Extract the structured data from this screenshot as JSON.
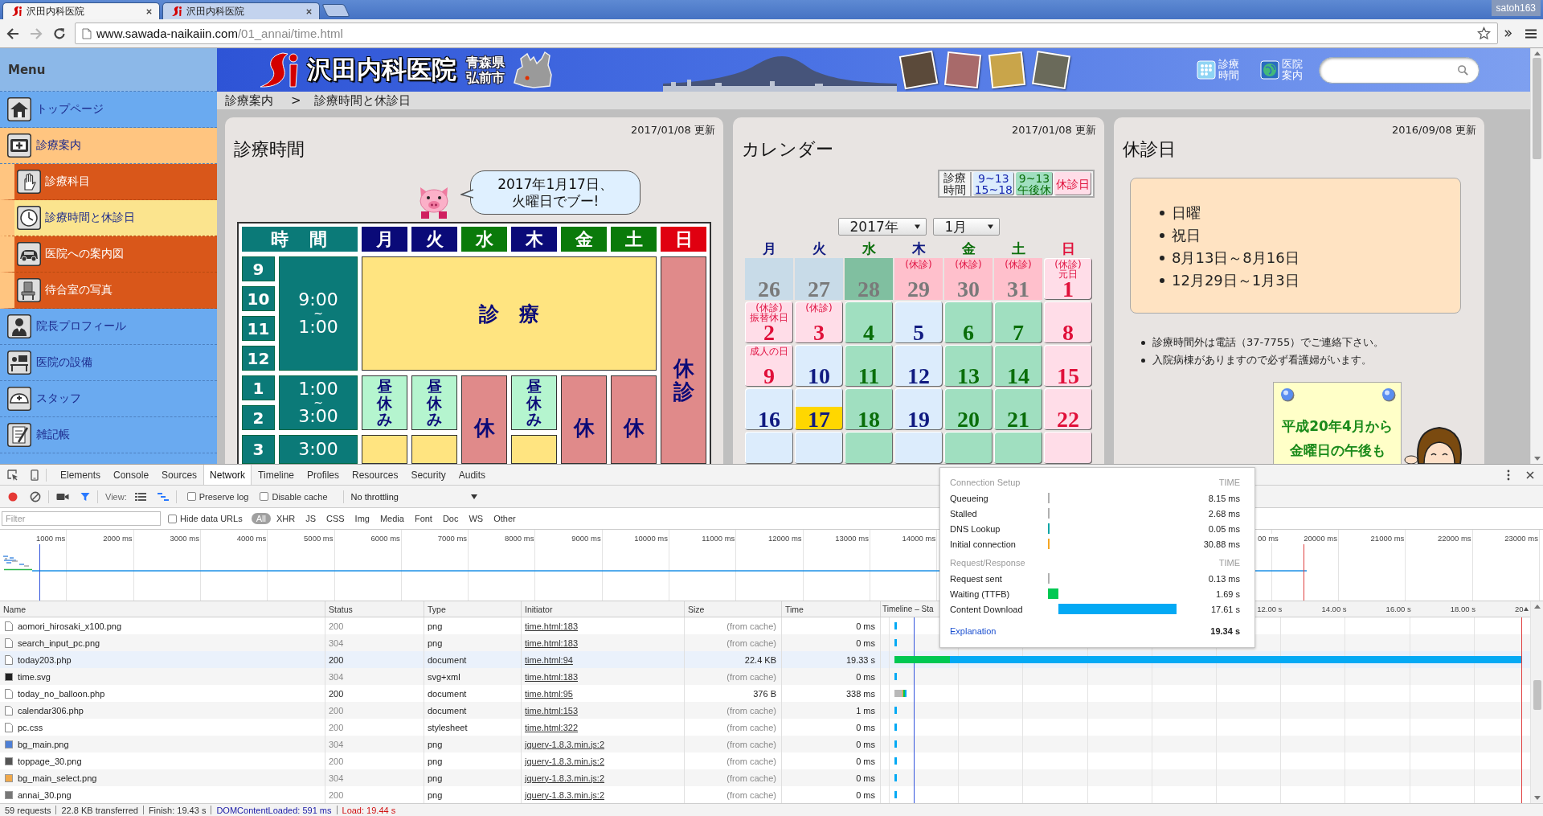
{
  "browser": {
    "tabs": [
      {
        "title": "沢田内科医院",
        "selected": true
      },
      {
        "title": "沢田内科医院",
        "selected": false
      }
    ],
    "profile": "satoh163",
    "address": {
      "host": "www.sawada-naikaiin.com",
      "path": "/01_annai/time.html"
    }
  },
  "sidebar": {
    "title": "Menu",
    "items": [
      {
        "label": "トップページ",
        "selected": false,
        "expanded": false
      },
      {
        "label": "診療案内",
        "selected": false,
        "expanded": true,
        "children": [
          {
            "label": "診療科目",
            "selected": false
          },
          {
            "label": "診療時間と休診日",
            "selected": true
          },
          {
            "label": "医院への案内図",
            "selected": false
          },
          {
            "label": "待合室の写真",
            "selected": false
          }
        ]
      },
      {
        "label": "院長プロフィール",
        "selected": false,
        "expanded": false
      },
      {
        "label": "医院の設備",
        "selected": false,
        "expanded": false
      },
      {
        "label": "スタッフ",
        "selected": false,
        "expanded": false
      },
      {
        "label": "雑記帳",
        "selected": false,
        "expanded": false
      }
    ]
  },
  "banner": {
    "clinic_name": "沢田内科医院",
    "location": [
      "青森県",
      "弘前市"
    ],
    "links": [
      {
        "label": "診療時間"
      },
      {
        "label": "医院案内"
      }
    ]
  },
  "breadcrumb": {
    "items": [
      "診療案内",
      "診療時間と休診日"
    ],
    "separator": ">"
  },
  "hours_panel": {
    "updated": "2017/01/08 更新",
    "title": "診療時間",
    "speech": [
      "2017年1月17日、",
      "火曜日でブー!"
    ],
    "table": {
      "columns": [
        {
          "label": "時　間",
          "color": "#0b7a78"
        },
        {
          "label": "月",
          "color": "#0a0a78"
        },
        {
          "label": "火",
          "color": "#0a0a78"
        },
        {
          "label": "水",
          "color": "#0a7a0a"
        },
        {
          "label": "木",
          "color": "#0a0a78"
        },
        {
          "label": "金",
          "color": "#0a7a0a"
        },
        {
          "label": "土",
          "color": "#0a7a0a"
        },
        {
          "label": "日",
          "color": "#e00010"
        }
      ],
      "hours": [
        "9",
        "10",
        "11",
        "12",
        "1",
        "2",
        "3"
      ],
      "ranges": [
        {
          "from": "9:00",
          "sep": "~",
          "to": "1:00"
        },
        {
          "from": "1:00",
          "sep": "~",
          "to": "3:00"
        },
        {
          "from": "3:00"
        }
      ],
      "morning": {
        "kind": "consult",
        "label": "診　療"
      },
      "afternoon": [
        {
          "kind": "lunch",
          "label": "昼休み"
        },
        {
          "kind": "lunch",
          "label": "昼休み"
        },
        {
          "kind": "closed",
          "label": "休"
        },
        {
          "kind": "lunch",
          "label": "昼休み"
        },
        {
          "kind": "closed",
          "label": "休"
        },
        {
          "kind": "closed",
          "label": "休"
        }
      ],
      "evening": [
        {
          "kind": "consult"
        },
        {
          "kind": "consult"
        },
        {
          "kind": "continued"
        },
        {
          "kind": "consult"
        },
        {
          "kind": "continued"
        },
        {
          "kind": "continued"
        }
      ],
      "sunday": {
        "kind": "closed",
        "label": "休診"
      }
    }
  },
  "calendar_panel": {
    "updated": "2017/01/08 更新",
    "title": "カレンダー",
    "legend": {
      "title": "診療時間",
      "items": [
        {
          "kind": "consult",
          "lines": [
            "9~13",
            "15~18"
          ]
        },
        {
          "kind": "half",
          "lines": [
            "9~13",
            "午後休"
          ]
        },
        {
          "kind": "closed",
          "lines": [
            "休診日"
          ]
        }
      ]
    },
    "year": "2017年",
    "month": "1月",
    "weekdays": [
      {
        "label": "月",
        "color": "#101a80"
      },
      {
        "label": "火",
        "color": "#101a80"
      },
      {
        "label": "水",
        "color": "#0a6e0a"
      },
      {
        "label": "木",
        "color": "#101a80"
      },
      {
        "label": "金",
        "color": "#0a6e0a"
      },
      {
        "label": "土",
        "color": "#0a6e0a"
      },
      {
        "label": "日",
        "color": "#e0103a"
      }
    ],
    "days": [
      {
        "day": "26",
        "kind": "consult",
        "in_month": false,
        "today": false
      },
      {
        "day": "27",
        "kind": "consult",
        "in_month": false,
        "today": false
      },
      {
        "day": "28",
        "kind": "half",
        "in_month": false,
        "today": false
      },
      {
        "day": "29",
        "kind": "closed",
        "in_month": false,
        "today": false,
        "notes": [
          "(休診)"
        ]
      },
      {
        "day": "30",
        "kind": "closed",
        "in_month": false,
        "today": false,
        "notes": [
          "(休診)"
        ]
      },
      {
        "day": "31",
        "kind": "closed",
        "in_month": false,
        "today": false,
        "notes": [
          "(休診)"
        ]
      },
      {
        "day": "1",
        "kind": "closed",
        "in_month": true,
        "today": false,
        "notes": [
          "(休診)",
          "元日"
        ]
      },
      {
        "day": "2",
        "kind": "closed",
        "in_month": true,
        "today": false,
        "notes": [
          "(休診)",
          "振替休日"
        ]
      },
      {
        "day": "3",
        "kind": "closed",
        "in_month": true,
        "today": false,
        "notes": [
          "(休診)"
        ]
      },
      {
        "day": "4",
        "kind": "half",
        "in_month": true,
        "today": false
      },
      {
        "day": "5",
        "kind": "consult",
        "in_month": true,
        "today": false
      },
      {
        "day": "6",
        "kind": "half",
        "in_month": true,
        "today": false
      },
      {
        "day": "7",
        "kind": "half",
        "in_month": true,
        "today": false
      },
      {
        "day": "8",
        "kind": "closed",
        "in_month": true,
        "today": false
      },
      {
        "day": "9",
        "kind": "closed",
        "in_month": true,
        "today": false,
        "notes": [
          "成人の日"
        ]
      },
      {
        "day": "10",
        "kind": "consult",
        "in_month": true,
        "today": false
      },
      {
        "day": "11",
        "kind": "half",
        "in_month": true,
        "today": false
      },
      {
        "day": "12",
        "kind": "consult",
        "in_month": true,
        "today": false
      },
      {
        "day": "13",
        "kind": "half",
        "in_month": true,
        "today": false
      },
      {
        "day": "14",
        "kind": "half",
        "in_month": true,
        "today": false
      },
      {
        "day": "15",
        "kind": "closed",
        "in_month": true,
        "today": false
      },
      {
        "day": "16",
        "kind": "consult",
        "in_month": true,
        "today": false
      },
      {
        "day": "17",
        "kind": "consult",
        "in_month": true,
        "today": true
      },
      {
        "day": "18",
        "kind": "half",
        "in_month": true,
        "today": false
      },
      {
        "day": "19",
        "kind": "consult",
        "in_month": true,
        "today": false
      },
      {
        "day": "20",
        "kind": "half",
        "in_month": true,
        "today": false
      },
      {
        "day": "21",
        "kind": "half",
        "in_month": true,
        "today": false
      },
      {
        "day": "22",
        "kind": "closed",
        "in_month": true,
        "today": false
      },
      {
        "kind": "consult",
        "in_month": true,
        "today": false
      },
      {
        "kind": "consult",
        "in_month": true,
        "today": false
      },
      {
        "kind": "half",
        "in_month": true,
        "today": false
      },
      {
        "kind": "consult",
        "in_month": true,
        "today": false
      },
      {
        "kind": "half",
        "in_month": true,
        "today": false
      },
      {
        "kind": "half",
        "in_month": true,
        "today": false
      },
      {
        "kind": "closed",
        "in_month": true,
        "today": false
      }
    ]
  },
  "closed_panel": {
    "updated": "2016/09/08 更新",
    "title": "休診日",
    "closed_days": [
      "日曜",
      "祝日",
      "8月13日～8月16日",
      "12月29日～1月3日"
    ],
    "notes": [
      "診療時間外は電話（37-7755）でご連絡下さい。",
      "入院病棟がありますので必ず看護婦がいます。"
    ],
    "notice": [
      "平成20年4月から",
      "金曜日の午後も"
    ]
  },
  "devtools": {
    "tabs": [
      {
        "label": "Elements",
        "selected": false
      },
      {
        "label": "Console",
        "selected": false
      },
      {
        "label": "Sources",
        "selected": false
      },
      {
        "label": "Network",
        "selected": true
      },
      {
        "label": "Timeline",
        "selected": false
      },
      {
        "label": "Profiles",
        "selected": false
      },
      {
        "label": "Resources",
        "selected": false
      },
      {
        "label": "Security",
        "selected": false
      },
      {
        "label": "Audits",
        "selected": false
      }
    ],
    "toolbar": {
      "recording": true,
      "filter_shown": true,
      "view_label": "View:",
      "large_rows": false,
      "overview": true,
      "options": [
        {
          "label": "Preserve log",
          "checked": false
        },
        {
          "label": "Disable cache",
          "checked": false
        }
      ],
      "throttling": "No throttling"
    },
    "filter_bar": {
      "placeholder": "Filter",
      "hide_data_urls": {
        "label": "Hide data URLs",
        "checked": false
      },
      "types": [
        {
          "label": "All",
          "selected": true
        },
        {
          "label": "XHR",
          "selected": false
        },
        {
          "label": "JS",
          "selected": false
        },
        {
          "label": "CSS",
          "selected": false
        },
        {
          "label": "Img",
          "selected": false
        },
        {
          "label": "Media",
          "selected": false
        },
        {
          "label": "Font",
          "selected": false
        },
        {
          "label": "Doc",
          "selected": false
        },
        {
          "label": "WS",
          "selected": false
        },
        {
          "label": "Other",
          "selected": false
        }
      ]
    },
    "overview": {
      "ticks_start": [
        "1000 ms",
        "2000 ms",
        "3000 ms",
        "4000 ms",
        "5000 ms",
        "6000 ms",
        "7000 ms",
        "8000 ms",
        "9000 ms",
        "10000 ms",
        "11000 ms",
        "12000 ms",
        "13000 ms",
        "14000 ms"
      ],
      "ticks_end": [
        "00 ms",
        "20000 ms",
        "21000 ms",
        "22000 ms",
        "23000 ms"
      ]
    },
    "table": {
      "columns": [
        "Name",
        "Status",
        "Type",
        "Initiator",
        "Size",
        "Time",
        "Timeline – Sta"
      ],
      "waterfall_ticks": [
        "12.00 s",
        "14.00 s",
        "16.00 s",
        "18.00 s",
        "20"
      ],
      "rows": [
        {
          "name": "aomori_hirosaki_x100.png",
          "status": "200",
          "type": "png",
          "initiator": "time.html:183",
          "size": "(from cache)",
          "time": "0 ms",
          "cached": true,
          "hovered": false,
          "kind": "cache"
        },
        {
          "name": "search_input_pc.png",
          "status": "304",
          "type": "png",
          "initiator": "time.html:183",
          "size": "(from cache)",
          "time": "0 ms",
          "cached": true,
          "hovered": false,
          "kind": "cache"
        },
        {
          "name": "today203.php",
          "status": "200",
          "type": "document",
          "initiator": "time.html:94",
          "size": "22.4 KB",
          "time": "19.33 s",
          "cached": false,
          "hovered": true,
          "kind": "long"
        },
        {
          "name": "time.svg",
          "status": "304",
          "type": "svg+xml",
          "initiator": "time.html:183",
          "size": "(from cache)",
          "time": "0 ms",
          "cached": true,
          "hovered": false,
          "kind": "cache"
        },
        {
          "name": "today_no_balloon.php",
          "status": "200",
          "type": "document",
          "initiator": "time.html:95",
          "size": "376 B",
          "time": "338 ms",
          "cached": false,
          "hovered": false,
          "kind": "short"
        },
        {
          "name": "calendar306.php",
          "status": "200",
          "type": "document",
          "initiator": "time.html:153",
          "size": "(from cache)",
          "time": "1 ms",
          "cached": true,
          "hovered": false,
          "kind": "cache"
        },
        {
          "name": "pc.css",
          "status": "200",
          "type": "stylesheet",
          "initiator": "time.html:322",
          "size": "(from cache)",
          "time": "0 ms",
          "cached": true,
          "hovered": false,
          "kind": "cache"
        },
        {
          "name": "bg_main.png",
          "status": "304",
          "type": "png",
          "initiator": "jquery-1.8.3.min.js:2",
          "size": "(from cache)",
          "time": "0 ms",
          "cached": true,
          "hovered": false,
          "kind": "cache"
        },
        {
          "name": "toppage_30.png",
          "status": "200",
          "type": "png",
          "initiator": "jquery-1.8.3.min.js:2",
          "size": "(from cache)",
          "time": "0 ms",
          "cached": true,
          "hovered": false,
          "kind": "cache"
        },
        {
          "name": "bg_main_select.png",
          "status": "304",
          "type": "png",
          "initiator": "jquery-1.8.3.min.js:2",
          "size": "(from cache)",
          "time": "0 ms",
          "cached": true,
          "hovered": false,
          "kind": "cache"
        },
        {
          "name": "annai_30.png",
          "status": "200",
          "type": "png",
          "initiator": "jquery-1.8.3.min.js:2",
          "size": "(from cache)",
          "time": "0 ms",
          "cached": true,
          "hovered": false,
          "kind": "cache"
        }
      ]
    },
    "status_bar": [
      {
        "text": "59 requests",
        "color": "#333333"
      },
      {
        "text": "22.8 KB transferred",
        "color": "#333333"
      },
      {
        "text": "Finish: 19.43 s",
        "color": "#333333"
      },
      {
        "text": "DOMContentLoaded: 591 ms",
        "color": "#1a1aa6"
      },
      {
        "text": "Load: 19.44 s",
        "color": "#d01010"
      }
    ],
    "timing": {
      "sections": [
        {
          "title": "Connection Setup",
          "time_label": "TIME",
          "rows": [
            {
              "label": "Queueing",
              "value": "8.15 ms",
              "kind": "queue"
            },
            {
              "label": "Stalled",
              "value": "2.68 ms",
              "kind": "stall"
            },
            {
              "label": "DNS Lookup",
              "value": "0.05 ms",
              "kind": "dns"
            },
            {
              "label": "Initial connection",
              "value": "30.88 ms",
              "kind": "connect"
            }
          ]
        },
        {
          "title": "Request/Response",
          "time_label": "TIME",
          "rows": [
            {
              "label": "Request sent",
              "value": "0.13 ms",
              "kind": "send"
            },
            {
              "label": "Waiting (TTFB)",
              "value": "1.69 s",
              "kind": "wait"
            },
            {
              "label": "Content Download",
              "value": "17.61 s",
              "kind": "download"
            }
          ]
        }
      ],
      "link": "Explanation",
      "total": "19.34 s"
    }
  }
}
